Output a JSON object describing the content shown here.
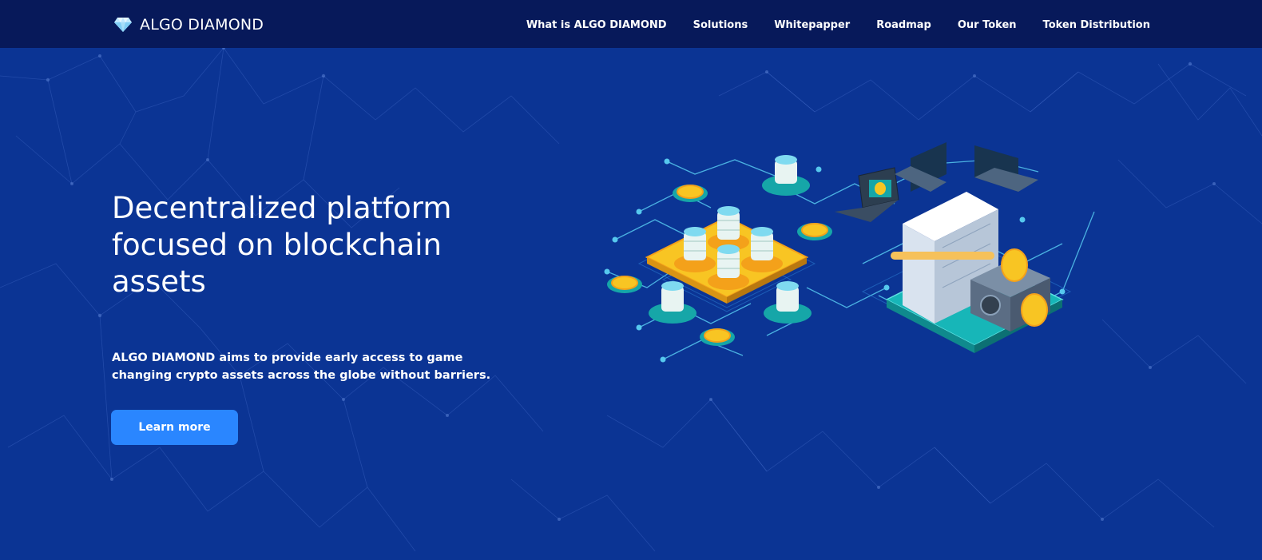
{
  "brand": {
    "name": "ALGO DIAMOND",
    "icon": "diamond-icon"
  },
  "nav": {
    "items": [
      {
        "label": "What is ALGO DIAMOND"
      },
      {
        "label": "Solutions"
      },
      {
        "label": "Whitepapper"
      },
      {
        "label": "Roadmap"
      },
      {
        "label": "Our Token"
      },
      {
        "label": "Token Distribution"
      }
    ]
  },
  "hero": {
    "title": "Decentralized platform focused on blockchain assets",
    "description": "ALGO DIAMOND aims to provide early access to game changing crypto assets across the globe without barriers.",
    "cta_label": "Learn more",
    "illustration": "blockchain-mining-illustration"
  },
  "colors": {
    "background": "#0b3494",
    "navbar": "#07195a",
    "button": "#2a86ff",
    "text": "#ffffff"
  }
}
